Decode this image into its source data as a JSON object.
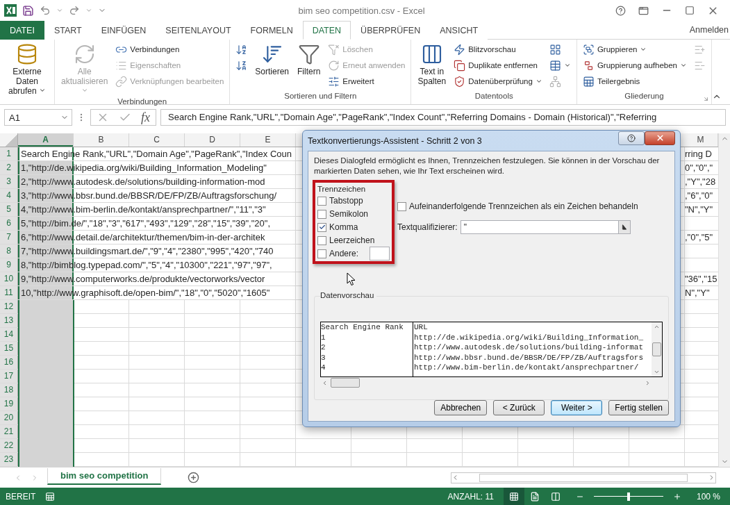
{
  "title_bar": {
    "title": "bim seo competition.csv - Excel"
  },
  "tabs": [
    {
      "label": "DATEI",
      "kind": "file",
      "selected": false
    },
    {
      "label": "START",
      "kind": "tab",
      "selected": false
    },
    {
      "label": "EINFÜGEN",
      "kind": "tab",
      "selected": false
    },
    {
      "label": "SEITENLAYOUT",
      "kind": "tab",
      "selected": false
    },
    {
      "label": "FORMELN",
      "kind": "tab",
      "selected": false
    },
    {
      "label": "DATEN",
      "kind": "tab",
      "selected": true
    },
    {
      "label": "ÜBERPRÜFEN",
      "kind": "tab",
      "selected": false
    },
    {
      "label": "ANSICHT",
      "kind": "tab",
      "selected": false
    }
  ],
  "account": "Anmelden",
  "ribbon": [
    {
      "items": [
        {
          "kind": "large",
          "label": "Externe Daten abrufen",
          "dropdown": true,
          "disabled": false
        }
      ]
    },
    {
      "label": "Verbindungen",
      "items": [
        {
          "kind": "large",
          "label": "Alle aktualisieren",
          "dropdown": true,
          "disabled": true
        },
        {
          "kind": "stack",
          "items": [
            {
              "label": "Verbindungen",
              "dropdown": false,
              "disabled": false
            },
            {
              "label": "Eigenschaften",
              "dropdown": false,
              "disabled": true
            },
            {
              "label": "Verknüpfungen bearbeiten",
              "dropdown": false,
              "disabled": true
            }
          ]
        }
      ]
    },
    {
      "label": "Sortieren und Filtern",
      "items": [
        {
          "kind": "stack",
          "items": [
            {
              "dropdown": false,
              "disabled": false
            },
            {
              "dropdown": false,
              "disabled": false
            }
          ]
        },
        {
          "kind": "large",
          "label": "Sortieren",
          "dropdown": false,
          "disabled": false
        },
        {
          "kind": "large",
          "label": "Filtern",
          "dropdown": false,
          "disabled": false
        },
        {
          "kind": "stack",
          "items": [
            {
              "label": "Löschen",
              "dropdown": false,
              "disabled": true
            },
            {
              "label": "Erneut anwenden",
              "dropdown": false,
              "disabled": true
            },
            {
              "label": "Erweitert",
              "dropdown": false,
              "disabled": false
            }
          ]
        }
      ]
    },
    {
      "label": "Datentools",
      "items": [
        {
          "kind": "large",
          "label": "Text in Spalten",
          "dropdown": false,
          "disabled": false
        },
        {
          "kind": "stack",
          "items": [
            {
              "label": "Blitzvorschau",
              "dropdown": false,
              "disabled": false
            },
            {
              "label": "Duplikate entfernen",
              "dropdown": false,
              "disabled": false
            },
            {
              "label": "Datenüberprüfung",
              "dropdown": true,
              "disabled": false
            }
          ]
        },
        {
          "kind": "stack",
          "items": [
            {
              "dropdown": false,
              "disabled": false
            },
            {
              "dropdown": true,
              "disabled": false
            },
            {
              "dropdown": false,
              "disabled": true
            }
          ]
        }
      ]
    },
    {
      "label": "Gliederung",
      "items": [
        {
          "kind": "stack",
          "items": [
            {
              "label": "Gruppieren",
              "dropdown": true,
              "disabled": false
            },
            {
              "label": "Gruppierung aufheben",
              "dropdown": true,
              "disabled": false
            },
            {
              "label": "Teilergebnis",
              "dropdown": false,
              "disabled": false
            }
          ]
        },
        {
          "kind": "stack",
          "items": [
            {
              "dropdown": false,
              "disabled": true
            },
            {
              "dropdown": false,
              "disabled": true
            }
          ]
        }
      ]
    }
  ],
  "formula_bar": {
    "name_box": "A1",
    "fx": "fx",
    "formula": "Search Engine Rank,\"URL\",\"Domain Age\",\"PageRank\",\"Index Count\",\"Referring Domains - Domain (Historical)\",\"Referring"
  },
  "grid": {
    "columns_left": [
      {
        "label": "A",
        "selected": true
      },
      {
        "label": "B",
        "selected": false
      },
      {
        "label": "C",
        "selected": false
      },
      {
        "label": "D",
        "selected": false
      },
      {
        "label": "E",
        "selected": false
      }
    ],
    "columns_right": [
      {
        "label": "M",
        "selected": false
      }
    ],
    "rows": [
      {
        "number": "1",
        "text": "Search Engine Rank,\"URL\",\"Domain Age\",\"PageRank\",\"Index Coun",
        "right_text": "rring D",
        "active": true
      },
      {
        "number": "2",
        "text": "1,\"http://de.wikipedia.org/wiki/Building_Information_Modeling\"",
        "right_text": "0\",\"0\",\"",
        "active": false
      },
      {
        "number": "3",
        "text": "2,\"http://www.autodesk.de/solutions/building-information-mod",
        "right_text": ",\"Y\",\"28",
        "active": false
      },
      {
        "number": "4",
        "text": "3,\"http://www.bbsr.bund.de/BBSR/DE/FP/ZB/Auftragsforschung/",
        "right_text": ",\"6\",\"0\"",
        "active": false
      },
      {
        "number": "5",
        "text": "4,\"http://www.bim-berlin.de/kontakt/ansprechpartner/\",\"11\",\"3\"",
        "right_text": "\"N\",\"Y\"",
        "active": false
      },
      {
        "number": "6",
        "text": "5,\"http://bim.de/\",\"18\",\"3\",\"617\",\"493\",\"129\",\"28\",\"15\",\"39\",\"20\",",
        "active": false
      },
      {
        "number": "7",
        "text": "6,\"http://www.detail.de/architektur/themen/bim-in-der-architek",
        "right_text": ",\"0\",\"5\"",
        "active": false
      },
      {
        "number": "8",
        "text": "7,\"http://www.buildingsmart.de/\",\"9\",\"4\",\"2380\",\"995\",\"420\",\"740",
        "active": false
      },
      {
        "number": "9",
        "text": "8,\"http://bimblog.typepad.com/\",\"5\",\"4\",\"10300\",\"221\",\"97\",\"97\",",
        "active": false
      },
      {
        "number": "10",
        "text": "9,\"http://www.computerworks.de/produkte/vectorworks/vector",
        "right_text": "\"36\",\"15",
        "active": false
      },
      {
        "number": "11",
        "text": "10,\"http://www.graphisoft.de/open-bim/\",\"18\",\"0\",\"5020\",\"1605\"",
        "right_text": "N\",\"Y\"",
        "active": false
      },
      {
        "number": "12",
        "active": false
      },
      {
        "number": "13",
        "active": false
      },
      {
        "number": "14",
        "active": false
      },
      {
        "number": "15",
        "active": false
      },
      {
        "number": "16",
        "active": false
      },
      {
        "number": "17",
        "active": false
      },
      {
        "number": "18",
        "active": false
      },
      {
        "number": "19",
        "active": false
      },
      {
        "number": "20",
        "active": false
      },
      {
        "number": "21",
        "active": false
      },
      {
        "number": "22",
        "active": false
      },
      {
        "number": "23",
        "active": false
      }
    ]
  },
  "dialog": {
    "title": "Textkonvertierungs-Assistent - Schritt 2 von 3",
    "description": "Dieses Dialogfeld ermöglicht es Ihnen, Trennzeichen festzulegen. Sie können in der Vorschau der markierten Daten sehen, wie Ihr Text erscheinen wird.",
    "separators": {
      "title": "Trennzeichen",
      "highlighted": true,
      "options": [
        {
          "label": "Tabstopp",
          "checked": false,
          "kind": "plain"
        },
        {
          "label": "Semikolon",
          "checked": false,
          "kind": "plain"
        },
        {
          "label": "Komma",
          "checked": true,
          "kind": "plain"
        },
        {
          "label": "Leerzeichen",
          "checked": false,
          "kind": "plain"
        },
        {
          "label": "Andere:",
          "checked": false,
          "kind": "field"
        }
      ]
    },
    "consecutive": {
      "label": "Aufeinanderfolgende Trennzeichen als ein Zeichen behandeln",
      "checked": false
    },
    "qualifier": {
      "label": "Textqualifizierer:",
      "value": "\""
    },
    "preview": {
      "title": "Datenvorschau",
      "columns": [
        "Search Engine Rank",
        "URL"
      ],
      "rows": [
        [
          "1",
          "http://de.wikipedia.org/wiki/Building_Information_"
        ],
        [
          "2",
          "http://www.autodesk.de/solutions/building-informat"
        ],
        [
          "3",
          "http://www.bbsr.bund.de/BBSR/DE/FP/ZB/Auftragsfors"
        ],
        [
          "4",
          "http://www.bim-berlin.de/kontakt/ansprechpartner/"
        ]
      ]
    },
    "buttons": [
      {
        "label": "Abbrechen",
        "default": false
      },
      {
        "label": "< Zurück",
        "default": false
      },
      {
        "label": "Weiter >",
        "default": true
      },
      {
        "label": "Fertig stellen",
        "default": false
      }
    ]
  },
  "sheet_tabs": [
    {
      "label": "bim seo competition",
      "selected": true
    }
  ],
  "status_bar": {
    "mode": "BEREIT",
    "count": "ANZAHL: 11",
    "views": [
      {
        "selected": true
      },
      {
        "selected": false
      },
      {
        "selected": false
      }
    ],
    "zoom": {
      "level": 0.5,
      "label": "100 %"
    }
  }
}
